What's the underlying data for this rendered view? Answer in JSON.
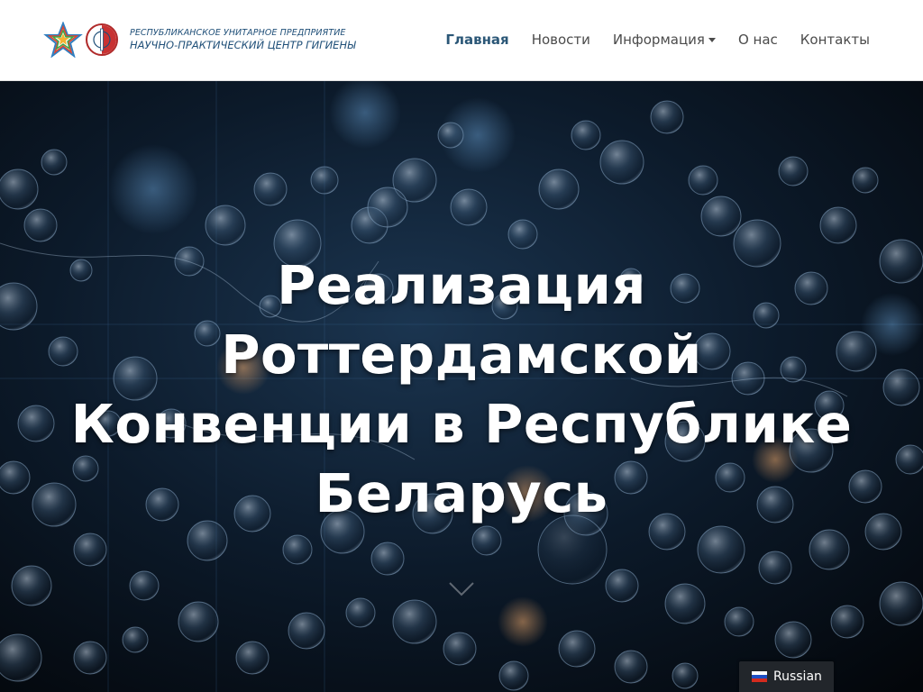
{
  "header": {
    "org_line1": "РЕСПУБЛИКАНСКОЕ УНИТАРНОЕ ПРЕДПРИЯТИЕ",
    "org_line2": "НАУЧНО-ПРАКТИЧЕСКИЙ ЦЕНТР ГИГИЕНЫ",
    "logo_icons": [
      "star-emblem-icon",
      "seal-emblem-icon"
    ]
  },
  "nav": {
    "items": [
      {
        "label": "Главная",
        "active": true
      },
      {
        "label": "Новости"
      },
      {
        "label": "Информация",
        "dropdown": true
      },
      {
        "label": "О нас"
      },
      {
        "label": "Контакты"
      }
    ]
  },
  "hero": {
    "title": "Реализация Роттердамской Конвенции в Республике Беларусь",
    "background": "molecules-bubbles-dark-blue"
  },
  "language": {
    "label": "Russian",
    "flag": "russia-flag-icon"
  },
  "colors": {
    "nav_active": "#2b5777",
    "nav_text": "#4b4b4b",
    "header_bg": "#ffffff",
    "logo_text": "#1f4f78",
    "lang_bg": "#22262b"
  }
}
